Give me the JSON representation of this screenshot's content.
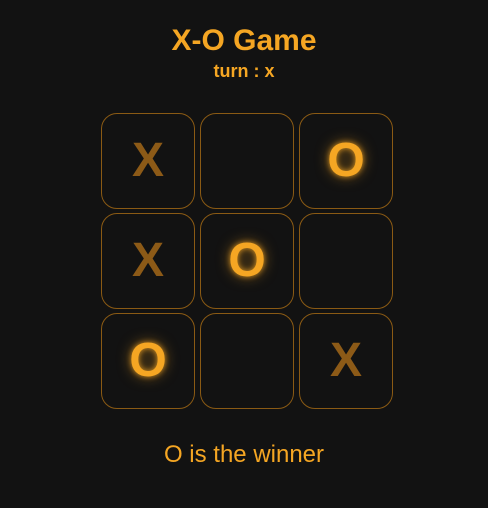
{
  "header": {
    "title": "X-O Game",
    "turn_text": "turn : x"
  },
  "board": {
    "cells": [
      {
        "value": "X"
      },
      {
        "value": ""
      },
      {
        "value": "O"
      },
      {
        "value": "X"
      },
      {
        "value": "O"
      },
      {
        "value": ""
      },
      {
        "value": "O"
      },
      {
        "value": ""
      },
      {
        "value": "X"
      }
    ]
  },
  "status": {
    "message": "O is the winner"
  },
  "colors": {
    "background": "#121212",
    "accent": "#f5a623",
    "x_mark": "#8c5a17",
    "cell_border": "#8a5a14"
  }
}
